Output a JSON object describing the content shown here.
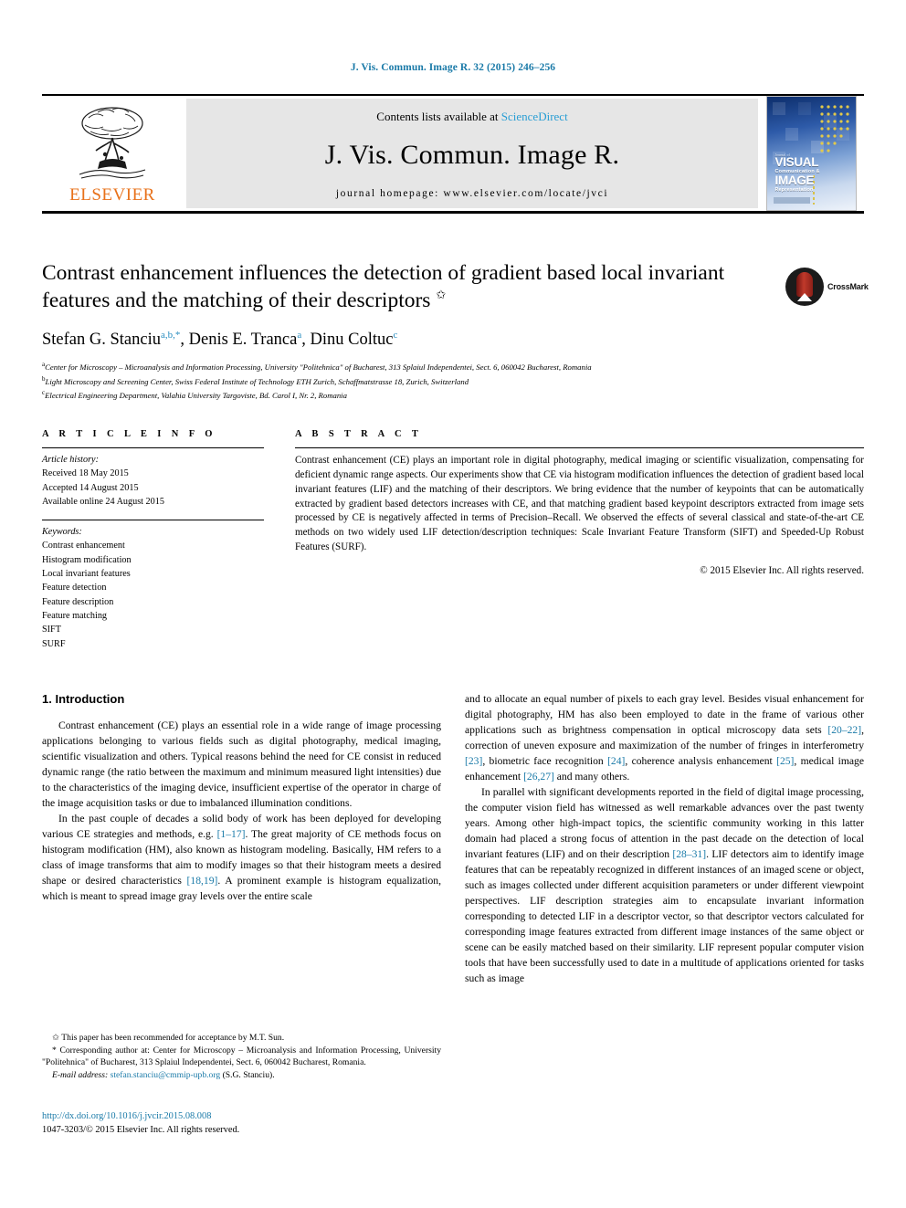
{
  "running_head": "J. Vis. Commun. Image R. 32 (2015) 246–256",
  "masthead": {
    "publisher": "ELSEVIER",
    "contents_prefix": "Contents lists available at ",
    "contents_link": "ScienceDirect",
    "journal_title": "J. Vis. Commun. Image R.",
    "homepage": "journal homepage: www.elsevier.com/locate/jvci",
    "cover": {
      "line1": "Journal of",
      "big1": "VISUAL",
      "mid1": "Communication &",
      "big2": "IMAGE",
      "mid2": "Representation"
    }
  },
  "title": {
    "text": "Contrast enhancement influences the detection of gradient based local invariant features and the matching of their descriptors",
    "footnote_marker": "✩"
  },
  "crossmark": {
    "label": "CrossMark"
  },
  "authors": {
    "list": [
      {
        "name": "Stefan G. Stanciu",
        "sup": "a,b,*"
      },
      {
        "name": "Denis E. Tranca",
        "sup": "a"
      },
      {
        "name": "Dinu Coltuc",
        "sup": "c"
      }
    ]
  },
  "affiliations": [
    {
      "mark": "a",
      "text": "Center for Microscopy – Microanalysis and Information Processing, University \"Politehnica\" of Bucharest, 313 Splaiul Independentei, Sect. 6, 060042 Bucharest, Romania"
    },
    {
      "mark": "b",
      "text": "Light Microscopy and Screening Center, Swiss Federal Institute of Technology ETH Zurich, Schaffmatstrasse 18, Zurich, Switzerland"
    },
    {
      "mark": "c",
      "text": "Electrical Engineering Department, Valahia University Targoviste, Bd. Carol I, Nr. 2, Romania"
    }
  ],
  "article_info": {
    "heading": "A R T I C L E   I N F O",
    "history_label": "Article history:",
    "history": [
      "Received 18 May 2015",
      "Accepted 14 August 2015",
      "Available online 24 August 2015"
    ],
    "keywords_label": "Keywords:",
    "keywords": [
      "Contrast enhancement",
      "Histogram modification",
      "Local invariant features",
      "Feature detection",
      "Feature description",
      "Feature matching",
      "SIFT",
      "SURF"
    ]
  },
  "abstract": {
    "heading": "A B S T R A C T",
    "text": "Contrast enhancement (CE) plays an important role in digital photography, medical imaging or scientific visualization, compensating for deficient dynamic range aspects. Our experiments show that CE via histogram modification influences the detection of gradient based local invariant features (LIF) and the matching of their descriptors. We bring evidence that the number of keypoints that can be automatically extracted by gradient based detectors increases with CE, and that matching gradient based keypoint descriptors extracted from image sets processed by CE is negatively affected in terms of Precision–Recall. We observed the effects of several classical and state-of-the-art CE methods on two widely used LIF detection/description techniques: Scale Invariant Feature Transform (SIFT) and Speeded-Up Robust Features (SURF).",
    "copyright": "© 2015 Elsevier Inc. All rights reserved."
  },
  "body": {
    "section_heading": "1. Introduction",
    "left_paragraphs": [
      "Contrast enhancement (CE) plays an essential role in a wide range of image processing applications belonging to various fields such as digital photography, medical imaging, scientific visualization and others. Typical reasons behind the need for CE consist in reduced dynamic range (the ratio between the maximum and minimum measured light intensities) due to the characteristics of the imaging device, insufficient expertise of the operator in charge of the image acquisition tasks or due to imbalanced illumination conditions.",
      "In the past couple of decades a solid body of work has been deployed for developing various CE strategies and methods, e.g. [1–17]. The great majority of CE methods focus on histogram modification (HM), also known as histogram modeling. Basically, HM refers to a class of image transforms that aim to modify images so that their histogram meets a desired shape or desired characteristics [18,19]. A prominent example is histogram equalization, which is meant to spread image gray levels over the entire scale"
    ],
    "right_paragraphs": [
      "and to allocate an equal number of pixels to each gray level. Besides visual enhancement for digital photography, HM has also been employed to date in the frame of various other applications such as brightness compensation in optical microscopy data sets [20–22], correction of uneven exposure and maximization of the number of fringes in interferometry [23], biometric face recognition [24], coherence analysis enhancement [25], medical image enhancement [26,27] and many others.",
      "In parallel with significant developments reported in the field of digital image processing, the computer vision field has witnessed as well remarkable advances over the past twenty years. Among other high-impact topics, the scientific community working in this latter domain had placed a strong focus of attention in the past decade on the detection of local invariant features (LIF) and on their description [28–31]. LIF detectors aim to identify image features that can be repeatably recognized in different instances of an imaged scene or object, such as images collected under different acquisition parameters or under different viewpoint perspectives. LIF description strategies aim to encapsulate invariant information corresponding to detected LIF in a descriptor vector, so that descriptor vectors calculated for corresponding image features extracted from different image instances of the same object or scene can be easily matched based on their similarity. LIF represent popular computer vision tools that have been successfully used to date in a multitude of applications oriented for tasks such as image"
    ]
  },
  "footnotes": {
    "star_note": "This paper has been recommended for acceptance by M.T. Sun.",
    "corresponding": "Corresponding author at: Center for Microscopy – Microanalysis and Information Processing, University \"Politehnica\" of Bucharest, 313 Splaiul Independentei, Sect. 6, 060042 Bucharest, Romania.",
    "email_label": "E-mail address:",
    "email": "stefan.stanciu@cmmip-upb.org",
    "email_owner": "(S.G. Stanciu)."
  },
  "doi_block": {
    "doi": "http://dx.doi.org/10.1016/j.jvcir.2015.08.008",
    "issn_line": "1047-3203/© 2015 Elsevier Inc. All rights reserved."
  },
  "colors": {
    "link": "#1a7aa8",
    "sciencedirect": "#2a9ed4",
    "elsevier_orange": "#e8711a"
  }
}
